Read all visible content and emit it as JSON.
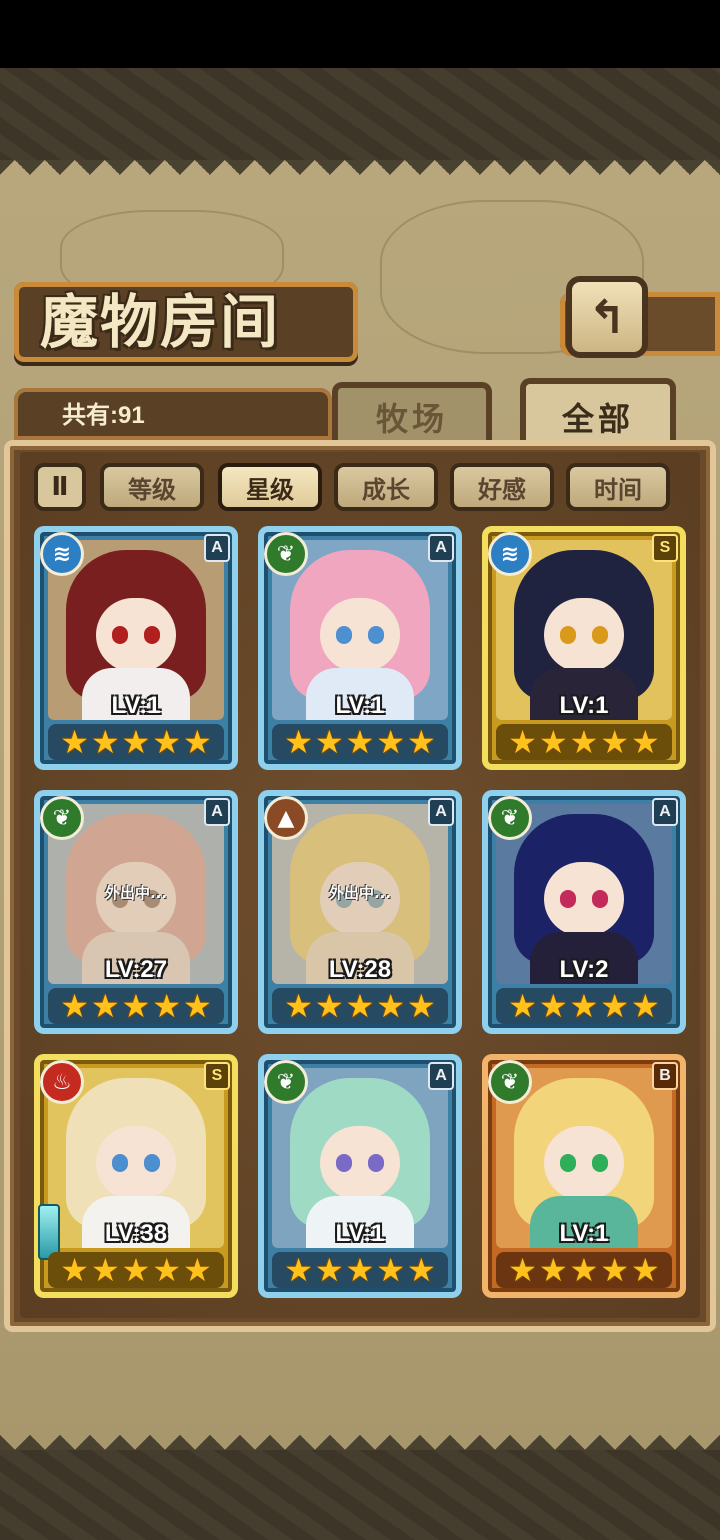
{
  "header": {
    "title": "魔物房间",
    "back_icon": "back-arrow-icon"
  },
  "summary": {
    "count_label": "共有:91"
  },
  "tabs": [
    {
      "label": "牧场",
      "active": false
    },
    {
      "label": "全部",
      "active": true
    }
  ],
  "sort_toggle": {
    "icon": "sort-order-icon",
    "label": "Ⅱ"
  },
  "filters": [
    {
      "label": "等级",
      "active": false
    },
    {
      "label": "星级",
      "active": true
    },
    {
      "label": "成长",
      "active": false
    },
    {
      "label": "好感",
      "active": false
    },
    {
      "label": "时间",
      "active": false
    }
  ],
  "monsters": [
    {
      "element": "water-icon",
      "rank": "A",
      "level": "LV:1",
      "stars": 5,
      "away": "",
      "frame": "blue"
    },
    {
      "element": "leaf-icon",
      "rank": "A",
      "level": "LV:1",
      "stars": 5,
      "away": "",
      "frame": "blue"
    },
    {
      "element": "water-icon",
      "rank": "S",
      "level": "LV:1",
      "stars": 5,
      "away": "",
      "frame": "gold"
    },
    {
      "element": "leaf-icon",
      "rank": "A",
      "level": "LV:27",
      "stars": 5,
      "away": "外出中...",
      "frame": "blue"
    },
    {
      "element": "mountain-icon",
      "rank": "A",
      "level": "LV:28",
      "stars": 5,
      "away": "外出中...",
      "frame": "blue"
    },
    {
      "element": "leaf-icon",
      "rank": "A",
      "level": "LV:2",
      "stars": 5,
      "away": "",
      "frame": "blue"
    },
    {
      "element": "flame-icon",
      "rank": "S",
      "level": "LV:38",
      "stars": 5,
      "away": "",
      "frame": "gold"
    },
    {
      "element": "leaf-icon",
      "rank": "A",
      "level": "LV:1",
      "stars": 5,
      "away": "",
      "frame": "blue"
    },
    {
      "element": "leaf-icon",
      "rank": "B",
      "level": "LV:1",
      "stars": 5,
      "away": "",
      "frame": "bronze"
    }
  ],
  "colors": {
    "water": "#2d7fc4",
    "grass": "#2f7a2b",
    "earth": "#8a4a25",
    "fire": "#c42a1f",
    "star": "#ffc21c"
  }
}
